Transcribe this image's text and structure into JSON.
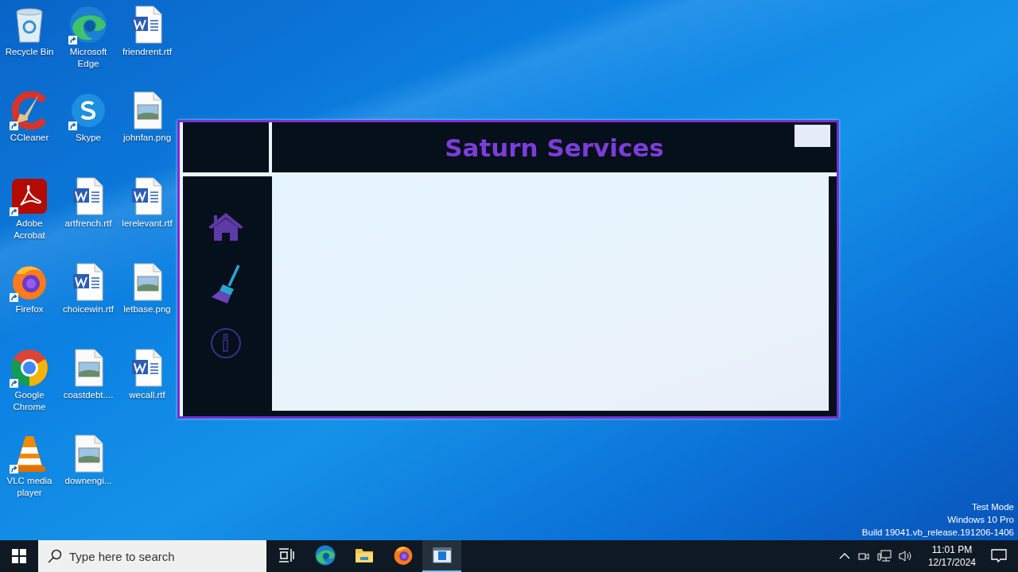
{
  "desktop_icons": [
    {
      "label": "Recycle Bin",
      "kind": "recycle",
      "shortcut": false
    },
    {
      "label": "Microsoft Edge",
      "kind": "edge",
      "shortcut": true
    },
    {
      "label": "friendrent.rtf",
      "kind": "word",
      "shortcut": false
    },
    {
      "label": "CCleaner",
      "kind": "ccleaner",
      "shortcut": true
    },
    {
      "label": "Skype",
      "kind": "skype",
      "shortcut": true
    },
    {
      "label": "johnfan.png",
      "kind": "image",
      "shortcut": false
    },
    {
      "label": "Adobe Acrobat",
      "kind": "acrobat",
      "shortcut": true
    },
    {
      "label": "artfrench.rtf",
      "kind": "word",
      "shortcut": false
    },
    {
      "label": "lerelevant.rtf",
      "kind": "word",
      "shortcut": false
    },
    {
      "label": "Firefox",
      "kind": "firefox",
      "shortcut": true
    },
    {
      "label": "choicewin.rtf",
      "kind": "word",
      "shortcut": false
    },
    {
      "label": "letbase.png",
      "kind": "image",
      "shortcut": false
    },
    {
      "label": "Google Chrome",
      "kind": "chrome",
      "shortcut": true
    },
    {
      "label": "coastdebt....",
      "kind": "image",
      "shortcut": false
    },
    {
      "label": "wecall.rtf",
      "kind": "word",
      "shortcut": false
    },
    {
      "label": "VLC media player",
      "kind": "vlc",
      "shortcut": true
    },
    {
      "label": "downengi...",
      "kind": "image",
      "shortcut": false
    }
  ],
  "app_window": {
    "title": "Saturn Services",
    "nav": [
      {
        "kind": "home"
      },
      {
        "kind": "broom"
      },
      {
        "kind": "info"
      }
    ]
  },
  "system_notice": [
    "Test Mode",
    "Windows 10 Pro",
    "Build 19041.vb_release.191206-1406"
  ],
  "taskbar": {
    "search": {
      "placeholder": "Type here to search"
    },
    "apps": [
      {
        "kind": "taskview",
        "active": false
      },
      {
        "kind": "edge",
        "active": false
      },
      {
        "kind": "explorer",
        "active": false
      },
      {
        "kind": "firefox",
        "active": false
      },
      {
        "kind": "app",
        "active": true
      }
    ],
    "clock": {
      "time": "11:01 PM",
      "date": "12/17/2024"
    }
  }
}
